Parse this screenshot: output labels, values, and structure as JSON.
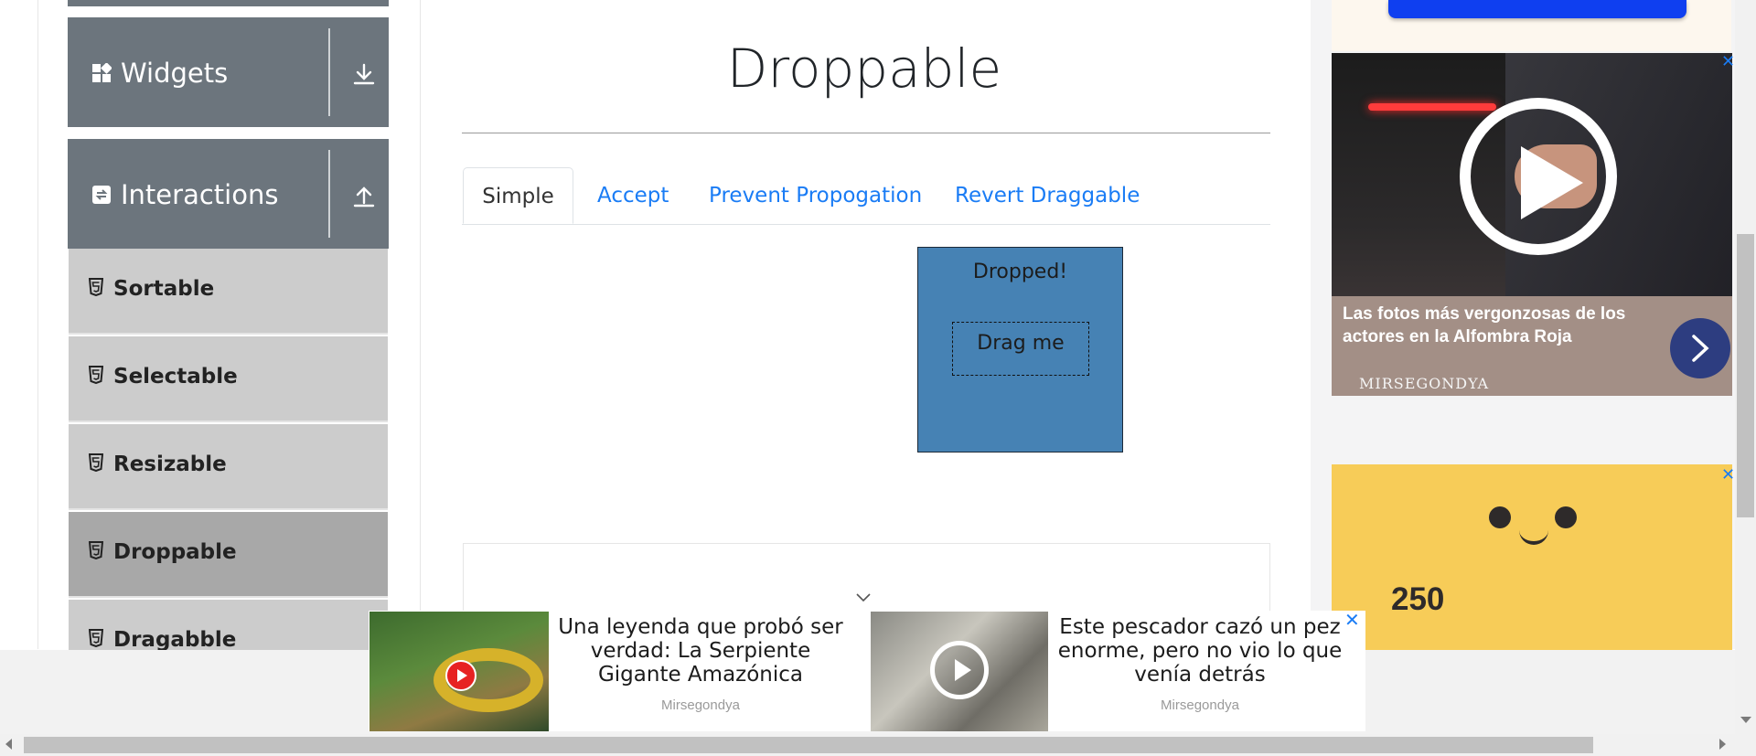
{
  "sidebar": {
    "groups": [
      {
        "label": "Widgets",
        "toggle_icon": "download-arrow-icon"
      },
      {
        "label": "Interactions",
        "toggle_icon": "upload-arrow-icon"
      }
    ],
    "items": [
      {
        "label": "Sortable",
        "active": false
      },
      {
        "label": "Selectable",
        "active": false
      },
      {
        "label": "Resizable",
        "active": false
      },
      {
        "label": "Droppable",
        "active": true
      },
      {
        "label": "Dragabble",
        "active": false
      }
    ]
  },
  "main": {
    "title": "Droppable",
    "tabs": [
      {
        "label": "Simple",
        "active": true
      },
      {
        "label": "Accept",
        "active": false
      },
      {
        "label": "Prevent Propogation",
        "active": false
      },
      {
        "label": "Revert Draggable",
        "active": false
      }
    ],
    "drop_target_text": "Dropped!",
    "drag_item_text": "Drag me"
  },
  "right_ad": {
    "headline": "Las fotos más vergonzosas de los actores en la Alfombra Roja",
    "brand": "MIRSEGONDYA",
    "close_symbol": "✕",
    "yellow_number": "250"
  },
  "bottom_ad": {
    "item1_text": "Una leyenda que probó ser verdad: La Serpiente Gigante Amazónica",
    "item1_source": "Mirsegondya",
    "item2_text": "Este pescador cazó un pez enorme, pero no vio lo que venía detrás",
    "item2_source": "Mirsegondya",
    "close_symbol": "✕"
  },
  "colors": {
    "sidebar_group": "#6c757d",
    "sidebar_item": "#cccccc",
    "sidebar_item_active": "#a8a8a8",
    "tab_link": "#1a7cf5",
    "drop_box": "#4682b4"
  }
}
